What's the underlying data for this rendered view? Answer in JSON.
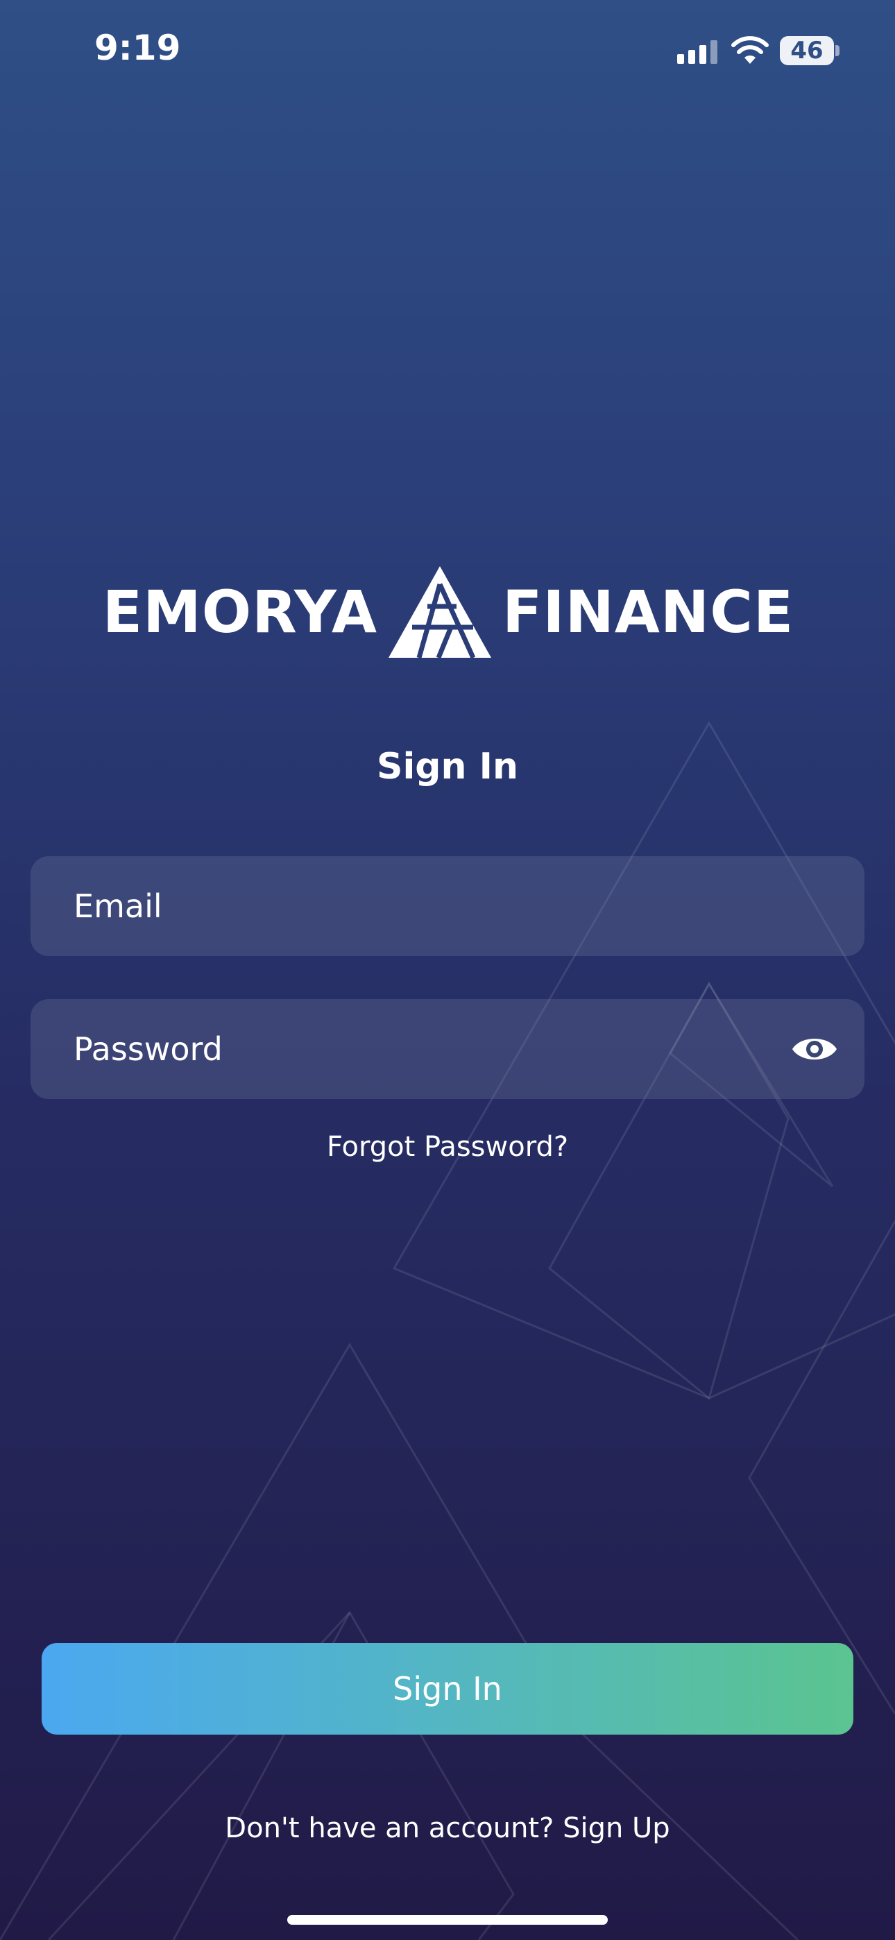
{
  "status_bar": {
    "time": "9:19",
    "battery_level": "46"
  },
  "logo": {
    "left_word": "EMORYA",
    "right_word": "FINANCE"
  },
  "page": {
    "title": "Sign In"
  },
  "form": {
    "email_placeholder": "Email",
    "password_placeholder": "Password",
    "forgot_password": "Forgot Password?",
    "submit_label": "Sign In"
  },
  "footer": {
    "prompt": "Don't have an account?",
    "signup_label": "Sign Up"
  },
  "colors": {
    "background_top": "#2f4f86",
    "background_bottom": "#211a47",
    "button_gradient_start": "#4ba8f0",
    "button_gradient_end": "#5bc48f"
  }
}
